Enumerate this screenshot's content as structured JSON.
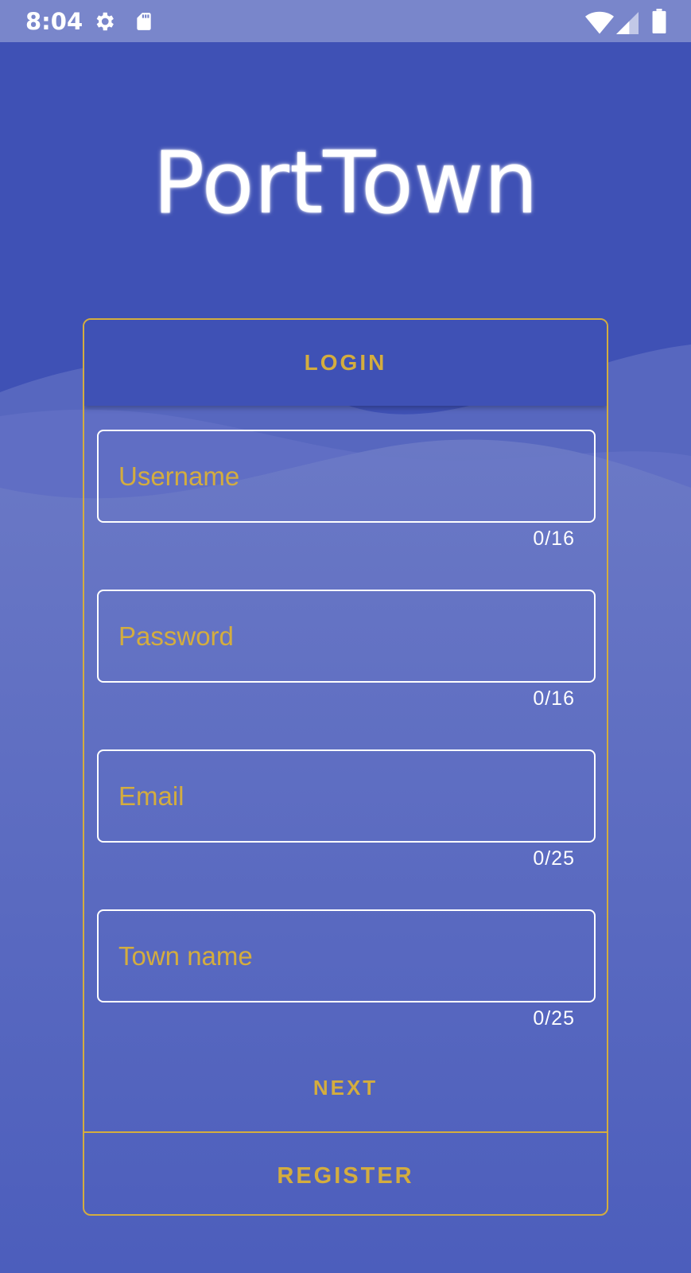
{
  "status_bar": {
    "time": "8:04",
    "left_icons": [
      "gear-icon",
      "sd-card-icon"
    ],
    "right_icons": [
      "wifi-icon",
      "cellular-signal-icon",
      "battery-icon"
    ]
  },
  "app": {
    "title": "PortTown"
  },
  "card": {
    "header_label": "LOGIN",
    "fields": [
      {
        "placeholder": "Username",
        "value": "",
        "counter": "0/16"
      },
      {
        "placeholder": "Password",
        "value": "",
        "counter": "0/16"
      },
      {
        "placeholder": "Email",
        "value": "",
        "counter": "0/25"
      },
      {
        "placeholder": "Town name",
        "value": "",
        "counter": "0/25"
      }
    ],
    "next_label": "NEXT",
    "register_label": "REGISTER"
  },
  "colors": {
    "primary": "#3f51b5",
    "status_bar": "#7986cb",
    "accent_gold": "#d4ad3e",
    "text_white": "#ffffff"
  }
}
